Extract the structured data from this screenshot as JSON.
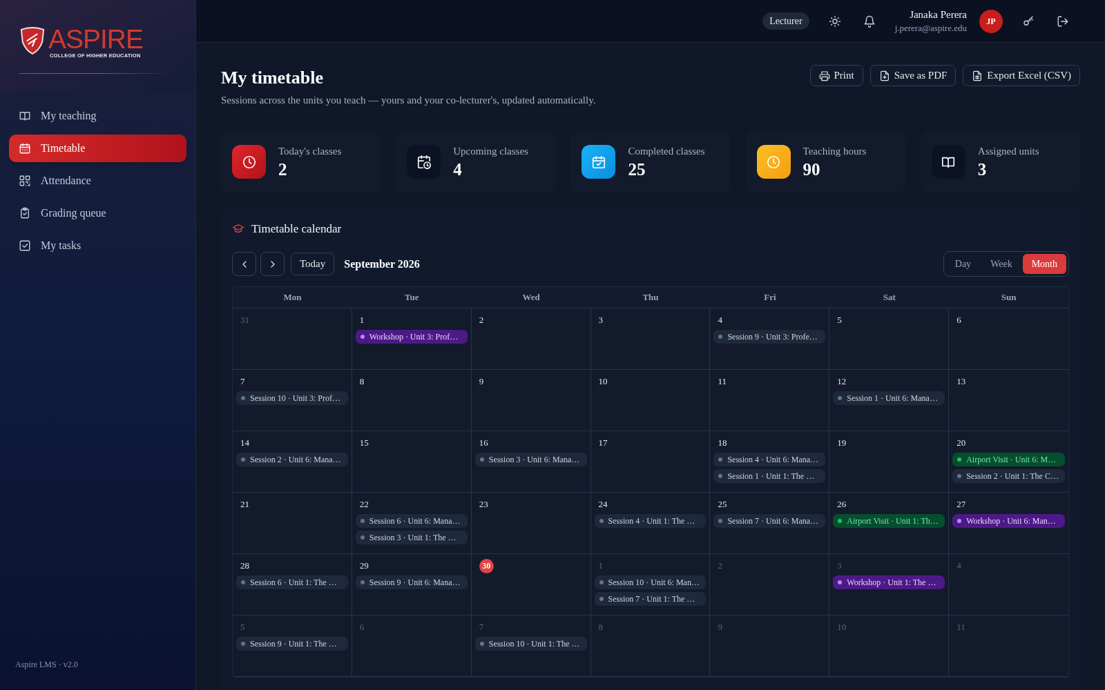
{
  "sidebar": {
    "logo": {
      "name": "ASPIRE",
      "tagline": "COLLEGE OF HIGHER EDUCATION"
    },
    "items": [
      {
        "label": "My teaching",
        "selected": false
      },
      {
        "label": "Timetable",
        "selected": true
      },
      {
        "label": "Attendance",
        "selected": false
      },
      {
        "label": "Grading queue",
        "selected": false
      },
      {
        "label": "My tasks",
        "selected": false
      }
    ],
    "footer": "Aspire LMS · v2.0"
  },
  "header": {
    "role": "Lecturer",
    "user": {
      "name": "Janaka Perera",
      "email": "j.perera@aspire.edu",
      "initials": "JP"
    }
  },
  "page": {
    "title": "My timetable",
    "subtitle": "Sessions across the units you teach — yours and your co-lecturer's, updated automatically.",
    "actions": [
      {
        "label": "Print"
      },
      {
        "label": "Save as PDF"
      },
      {
        "label": "Export Excel (CSV)"
      }
    ]
  },
  "stats": [
    {
      "label": "Today's classes",
      "value": "2"
    },
    {
      "label": "Upcoming classes",
      "value": "4"
    },
    {
      "label": "Completed classes",
      "value": "25"
    },
    {
      "label": "Teaching hours",
      "value": "90"
    },
    {
      "label": "Assigned units",
      "value": "3"
    }
  ],
  "calendar": {
    "title": "Timetable calendar",
    "today_button": "Today",
    "month": "September 2026",
    "views": [
      {
        "label": "Day",
        "selected": false
      },
      {
        "label": "Week",
        "selected": false
      },
      {
        "label": "Month",
        "selected": true
      }
    ],
    "weekdays": [
      "Mon",
      "Tue",
      "Wed",
      "Thu",
      "Fri",
      "Sat",
      "Sun"
    ],
    "weeks": [
      [
        {
          "day": "31",
          "in_month": false,
          "today": false
        },
        {
          "day": "1",
          "in_month": true,
          "today": false,
          "events": [
            {
              "kind": "workshop",
              "label": "Workshop · Unit 3: Prof…"
            }
          ]
        },
        {
          "day": "2",
          "in_month": true,
          "today": false
        },
        {
          "day": "3",
          "in_month": true,
          "today": false
        },
        {
          "day": "4",
          "in_month": true,
          "today": false,
          "events": [
            {
              "kind": "session",
              "label": "Session 9 · Unit 3: Profe…"
            }
          ]
        },
        {
          "day": "5",
          "in_month": true,
          "today": false
        },
        {
          "day": "6",
          "in_month": true,
          "today": false
        }
      ],
      [
        {
          "day": "7",
          "in_month": true,
          "today": false,
          "events": [
            {
              "kind": "session",
              "label": "Session 10 · Unit 3: Prof…"
            }
          ]
        },
        {
          "day": "8",
          "in_month": true,
          "today": false
        },
        {
          "day": "9",
          "in_month": true,
          "today": false
        },
        {
          "day": "10",
          "in_month": true,
          "today": false
        },
        {
          "day": "11",
          "in_month": true,
          "today": false
        },
        {
          "day": "12",
          "in_month": true,
          "today": false,
          "events": [
            {
              "kind": "session",
              "label": "Session 1 · Unit 6: Mana…"
            }
          ]
        },
        {
          "day": "13",
          "in_month": true,
          "today": false
        }
      ],
      [
        {
          "day": "14",
          "in_month": true,
          "today": false,
          "events": [
            {
              "kind": "session",
              "label": "Session 2 · Unit 6: Mana…"
            }
          ]
        },
        {
          "day": "15",
          "in_month": true,
          "today": false
        },
        {
          "day": "16",
          "in_month": true,
          "today": false,
          "events": [
            {
              "kind": "session",
              "label": "Session 3 · Unit 6: Mana…"
            }
          ]
        },
        {
          "day": "17",
          "in_month": true,
          "today": false
        },
        {
          "day": "18",
          "in_month": true,
          "today": false,
          "events": [
            {
              "kind": "session",
              "label": "Session 4 · Unit 6: Mana…"
            },
            {
              "kind": "session",
              "label": "Session 1 · Unit 1: The …"
            }
          ]
        },
        {
          "day": "19",
          "in_month": true,
          "today": false
        },
        {
          "day": "20",
          "in_month": true,
          "today": false,
          "events": [
            {
              "kind": "airport",
              "label": "Airport Visit · Unit 6: M…"
            },
            {
              "kind": "session",
              "label": "Session 2 · Unit 1: The C…"
            }
          ]
        }
      ],
      [
        {
          "day": "21",
          "in_month": true,
          "today": false
        },
        {
          "day": "22",
          "in_month": true,
          "today": false,
          "events": [
            {
              "kind": "session",
              "label": "Session 6 · Unit 6: Mana…"
            },
            {
              "kind": "session",
              "label": "Session 3 · Unit 1: The …"
            }
          ]
        },
        {
          "day": "23",
          "in_month": true,
          "today": false
        },
        {
          "day": "24",
          "in_month": true,
          "today": false,
          "events": [
            {
              "kind": "session",
              "label": "Session 4 · Unit 1: The …"
            }
          ]
        },
        {
          "day": "25",
          "in_month": true,
          "today": false,
          "events": [
            {
              "kind": "session",
              "label": "Session 7 · Unit 6: Mana…"
            }
          ]
        },
        {
          "day": "26",
          "in_month": true,
          "today": false,
          "events": [
            {
              "kind": "airport",
              "label": "Airport Visit · Unit 1: Th…"
            }
          ]
        },
        {
          "day": "27",
          "in_month": true,
          "today": false,
          "events": [
            {
              "kind": "workshop",
              "label": "Workshop · Unit 6: Man…"
            }
          ]
        }
      ],
      [
        {
          "day": "28",
          "in_month": true,
          "today": false,
          "events": [
            {
              "kind": "session",
              "label": "Session 6 · Unit 1: The …"
            }
          ]
        },
        {
          "day": "29",
          "in_month": true,
          "today": false,
          "events": [
            {
              "kind": "session",
              "label": "Session 9 · Unit 6: Mana…"
            }
          ]
        },
        {
          "day": "30",
          "in_month": true,
          "today": true
        },
        {
          "day": "1",
          "in_month": false,
          "today": false,
          "events": [
            {
              "kind": "session",
              "label": "Session 10 · Unit 6: Man…"
            },
            {
              "kind": "session",
              "label": "Session 7 · Unit 1: The …"
            }
          ]
        },
        {
          "day": "2",
          "in_month": false,
          "today": false
        },
        {
          "day": "3",
          "in_month": false,
          "today": false,
          "events": [
            {
              "kind": "workshop",
              "label": "Workshop · Unit 1: The …"
            }
          ]
        },
        {
          "day": "4",
          "in_month": false,
          "today": false
        }
      ],
      [
        {
          "day": "5",
          "in_month": false,
          "today": false,
          "events": [
            {
              "kind": "session",
              "label": "Session 9 · Unit 1: The …"
            }
          ]
        },
        {
          "day": "6",
          "in_month": false,
          "today": false
        },
        {
          "day": "7",
          "in_month": false,
          "today": false,
          "events": [
            {
              "kind": "session",
              "label": "Session 10 · Unit 1: The …"
            }
          ]
        },
        {
          "day": "8",
          "in_month": false,
          "today": false
        },
        {
          "day": "9",
          "in_month": false,
          "today": false
        },
        {
          "day": "10",
          "in_month": false,
          "today": false
        },
        {
          "day": "11",
          "in_month": false,
          "today": false
        }
      ]
    ]
  }
}
